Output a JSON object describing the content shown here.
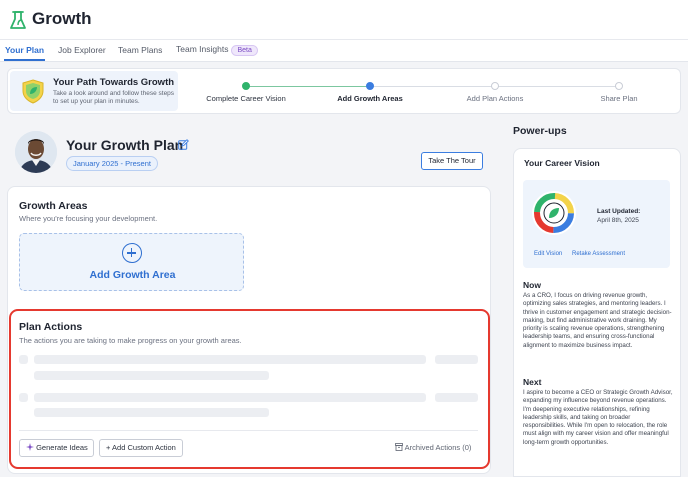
{
  "app": {
    "title": "Growth"
  },
  "tabs": [
    {
      "label": "Your Plan",
      "active": true
    },
    {
      "label": "Job Explorer",
      "active": false
    },
    {
      "label": "Team Plans",
      "active": false
    },
    {
      "label": "Team Insights",
      "active": false,
      "badge": "Beta"
    }
  ],
  "path": {
    "title": "Your Path Towards Growth",
    "subtitle": "Take a look around and follow these steps to set up your plan in minutes.",
    "steps": [
      {
        "label": "Complete Career Vision",
        "state": "done"
      },
      {
        "label": "Add Growth Areas",
        "state": "current"
      },
      {
        "label": "Add Plan Actions",
        "state": "todo"
      },
      {
        "label": "Share Plan",
        "state": "todo"
      }
    ]
  },
  "plan": {
    "title": "Your Growth Plan",
    "date_range": "January 2025 - Present",
    "tour_label": "Take The Tour"
  },
  "growth_areas": {
    "title": "Growth Areas",
    "subtitle": "Where you're focusing your development.",
    "add_label": "Add Growth Area"
  },
  "plan_actions": {
    "title": "Plan Actions",
    "subtitle": "The actions you are taking to make progress on your growth areas.",
    "generate_label": "Generate Ideas",
    "custom_label": "+ Add Custom Action",
    "archived_label": "Archived Actions (0)"
  },
  "powerups": {
    "title": "Power-ups",
    "card_title": "Your Career Vision",
    "last_updated_label": "Last Updated:",
    "last_updated_date": "April 8th, 2025",
    "edit_label": "Edit Vision",
    "retake_label": "Retake Assessment",
    "now_title": "Now",
    "now_text": "As a CRO, I focus on driving revenue growth, optimizing sales strategies, and mentoring leaders. I thrive in customer engagement and strategic decision-making, but find administrative work draining. My priority is scaling revenue operations, strengthening leadership teams, and ensuring cross-functional alignment to maximize business impact.",
    "next_title": "Next",
    "next_text": "I aspire to become a CEO or Strategic Growth Advisor, expanding my influence beyond revenue operations. I'm deepening executive relationships, refining leadership skills, and taking on broader responsibilities. While I'm open to relocation, the role must align with my career vision and offer meaningful long-term growth opportunities."
  },
  "colors": {
    "accent": "#2f6fd0",
    "success": "#2fb36b",
    "highlight": "#e5392f"
  },
  "icons": [
    "growth-logo-icon",
    "shield-leaf-icon",
    "edit-icon",
    "plus-circle-icon",
    "sparkle-icon",
    "archive-icon",
    "vision-gauge-icon"
  ]
}
